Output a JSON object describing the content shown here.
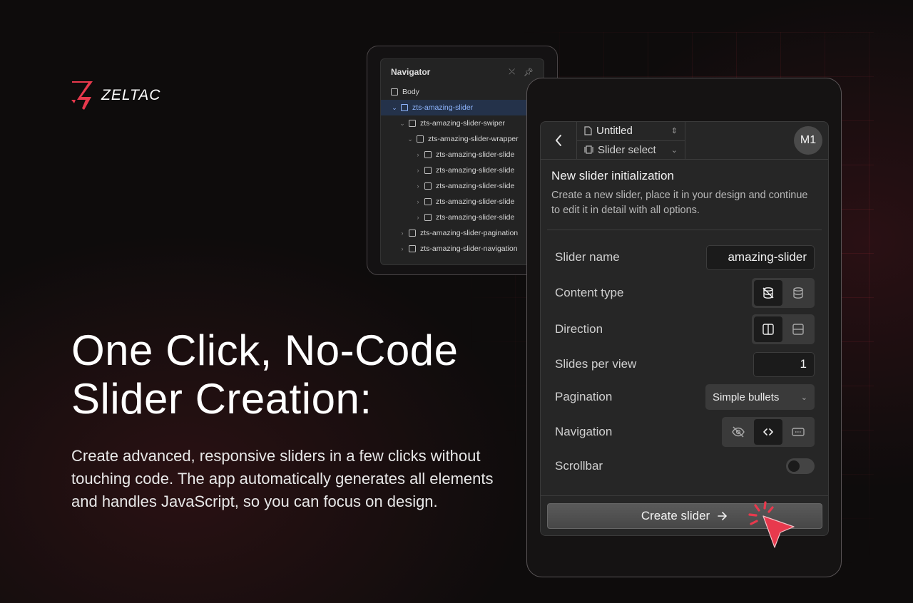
{
  "brand": {
    "name": "ZELTAC",
    "accent_color": "#e8394d"
  },
  "hero": {
    "title_line1": "One Click, No-Code",
    "title_line2": "Slider Creation:",
    "description": "Create advanced, responsive sliders in a few clicks without touching code. The app automatically generates all elements and handles JavaScript, so you can focus on design."
  },
  "navigator": {
    "title": "Navigator",
    "items": [
      {
        "label": "Body"
      },
      {
        "label": "zts-amazing-slider"
      },
      {
        "label": "zts-amazing-slider-swiper"
      },
      {
        "label": "zts-amazing-slider-wrapper"
      },
      {
        "label": "zts-amazing-slider-slide"
      },
      {
        "label": "zts-amazing-slider-slide"
      },
      {
        "label": "zts-amazing-slider-slide"
      },
      {
        "label": "zts-amazing-slider-slide"
      },
      {
        "label": "zts-amazing-slider-slide"
      },
      {
        "label": "zts-amazing-slider-pagination"
      },
      {
        "label": "zts-amazing-slider-navigation"
      }
    ]
  },
  "app": {
    "page_select": "Untitled",
    "slider_select": "Slider select",
    "avatar": "M1",
    "intro_title": "New slider initialization",
    "intro_desc": "Create a new slider, place it in your design and continue to edit it in detail with all options.",
    "fields": {
      "slider_name_label": "Slider name",
      "slider_name_value": "amazing-slider",
      "content_type_label": "Content type",
      "direction_label": "Direction",
      "slides_per_view_label": "Slides per view",
      "slides_per_view_value": "1",
      "pagination_label": "Pagination",
      "pagination_value": "Simple bullets",
      "navigation_label": "Navigation",
      "scrollbar_label": "Scrollbar"
    },
    "create_button": "Create slider"
  }
}
